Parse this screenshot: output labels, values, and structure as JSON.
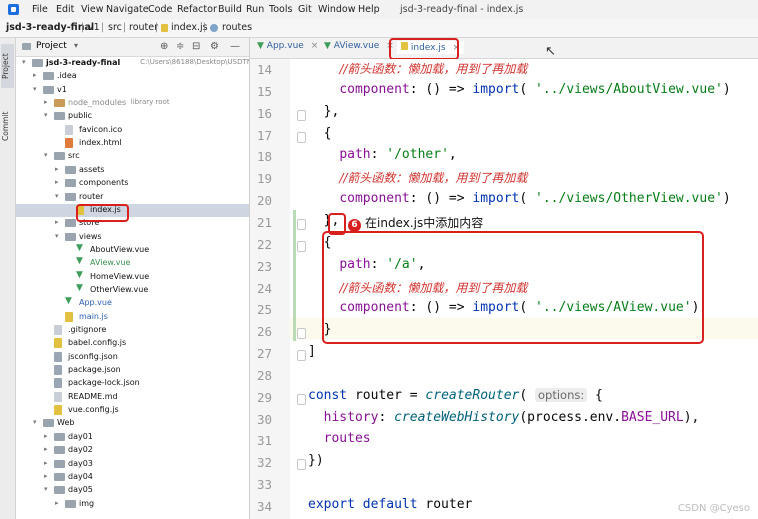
{
  "menubar": {
    "items": [
      "File",
      "Edit",
      "View",
      "Navigate",
      "Code",
      "Refactor",
      "Build",
      "Run",
      "Tools",
      "Git",
      "Window",
      "Help"
    ],
    "window_title": "jsd-3-ready-final - index.js"
  },
  "breadcrumb": [
    "jsd-3-ready-final",
    "v1",
    "src",
    "router",
    "index.js",
    "routes"
  ],
  "side_strip": {
    "project_tab": "Project",
    "commit_tab": "Commit"
  },
  "project_panel": {
    "title": "Project",
    "tree": [
      {
        "label": "jsd-3-ready-final",
        "extra": "C:\\Users\\86188\\Desktop\\USDTN-3",
        "indent": 0,
        "kind": "folder",
        "open": true
      },
      {
        "label": ".idea",
        "indent": 1,
        "kind": "folder",
        "open": false
      },
      {
        "label": "v1",
        "indent": 1,
        "kind": "folder",
        "open": true
      },
      {
        "label": "node_modules",
        "extra": "library root",
        "indent": 2,
        "kind": "folder-orange",
        "open": false,
        "muted": true
      },
      {
        "label": "public",
        "indent": 2,
        "kind": "folder",
        "open": true
      },
      {
        "label": "favicon.ico",
        "indent": 3,
        "kind": "file"
      },
      {
        "label": "index.html",
        "indent": 3,
        "kind": "html"
      },
      {
        "label": "src",
        "indent": 2,
        "kind": "folder",
        "open": true
      },
      {
        "label": "assets",
        "indent": 3,
        "kind": "folder",
        "open": false
      },
      {
        "label": "components",
        "indent": 3,
        "kind": "folder",
        "open": false
      },
      {
        "label": "router",
        "indent": 3,
        "kind": "folder",
        "open": true
      },
      {
        "label": "index.js",
        "indent": 4,
        "kind": "js",
        "selected": true
      },
      {
        "label": "store",
        "indent": 3,
        "kind": "folder",
        "open": false
      },
      {
        "label": "views",
        "indent": 3,
        "kind": "folder",
        "open": true
      },
      {
        "label": "AboutView.vue",
        "indent": 4,
        "kind": "vue"
      },
      {
        "label": "AView.vue",
        "indent": 4,
        "kind": "vue",
        "green": true
      },
      {
        "label": "HomeView.vue",
        "indent": 4,
        "kind": "vue"
      },
      {
        "label": "OtherView.vue",
        "indent": 4,
        "kind": "vue"
      },
      {
        "label": "App.vue",
        "indent": 3,
        "kind": "vue",
        "blue": true
      },
      {
        "label": "main.js",
        "indent": 3,
        "kind": "js",
        "blue": true
      },
      {
        "label": ".gitignore",
        "indent": 2,
        "kind": "file"
      },
      {
        "label": "babel.config.js",
        "indent": 2,
        "kind": "js"
      },
      {
        "label": "jsconfig.json",
        "indent": 2,
        "kind": "json"
      },
      {
        "label": "package.json",
        "indent": 2,
        "kind": "json"
      },
      {
        "label": "package-lock.json",
        "indent": 2,
        "kind": "json"
      },
      {
        "label": "README.md",
        "indent": 2,
        "kind": "file"
      },
      {
        "label": "vue.config.js",
        "indent": 2,
        "kind": "js"
      },
      {
        "label": "Web",
        "indent": 1,
        "kind": "folder",
        "open": true
      },
      {
        "label": "day01",
        "indent": 2,
        "kind": "folder",
        "open": false
      },
      {
        "label": "day02",
        "indent": 2,
        "kind": "folder",
        "open": false
      },
      {
        "label": "day03",
        "indent": 2,
        "kind": "folder",
        "open": false
      },
      {
        "label": "day04",
        "indent": 2,
        "kind": "folder",
        "open": false
      },
      {
        "label": "day05",
        "indent": 2,
        "kind": "folder",
        "open": true
      },
      {
        "label": "img",
        "indent": 3,
        "kind": "folder",
        "open": false
      }
    ]
  },
  "editor_tabs": [
    "App.vue",
    "AView.vue",
    "index.js"
  ],
  "editor": {
    "lines": [
      {
        "n": "14",
        "tokens": [
          [
            "    ",
            ""
          ],
          [
            "//箭头函数：懒加载，用到了再加载",
            "cmtc"
          ]
        ]
      },
      {
        "n": "15",
        "tokens": [
          [
            "    ",
            ""
          ],
          [
            "component",
            "prop"
          ],
          [
            ": () => ",
            ""
          ],
          [
            "import",
            "kw"
          ],
          [
            "( ",
            ""
          ],
          [
            "'../views/AboutView.vue'",
            "str"
          ],
          [
            ")",
            ""
          ]
        ]
      },
      {
        "n": "16",
        "tokens": [
          [
            "  },",
            ""
          ]
        ]
      },
      {
        "n": "17",
        "tokens": [
          [
            "  {",
            ""
          ]
        ]
      },
      {
        "n": "18",
        "tokens": [
          [
            "    ",
            ""
          ],
          [
            "path",
            "prop"
          ],
          [
            ": ",
            ""
          ],
          [
            "'/other'",
            "str"
          ],
          [
            ",",
            ""
          ]
        ]
      },
      {
        "n": "19",
        "tokens": [
          [
            "    ",
            ""
          ],
          [
            "//箭头函数：懒加载，用到了再加载",
            "cmtc"
          ]
        ]
      },
      {
        "n": "20",
        "tokens": [
          [
            "    ",
            ""
          ],
          [
            "component",
            "prop"
          ],
          [
            ": () => ",
            ""
          ],
          [
            "import",
            "kw"
          ],
          [
            "( ",
            ""
          ],
          [
            "'../views/OtherView.vue'",
            "str"
          ],
          [
            ")",
            ""
          ]
        ]
      },
      {
        "n": "21",
        "tokens": [
          [
            "  },",
            ""
          ]
        ]
      },
      {
        "n": "22",
        "tokens": [
          [
            "  {",
            ""
          ]
        ]
      },
      {
        "n": "23",
        "tokens": [
          [
            "    ",
            ""
          ],
          [
            "path",
            "prop"
          ],
          [
            ": ",
            ""
          ],
          [
            "'/a'",
            "str"
          ],
          [
            ",",
            ""
          ]
        ]
      },
      {
        "n": "24",
        "tokens": [
          [
            "    ",
            ""
          ],
          [
            "//箭头函数：懒加载，用到了再加载",
            "cmtc"
          ]
        ]
      },
      {
        "n": "25",
        "tokens": [
          [
            "    ",
            ""
          ],
          [
            "component",
            "prop"
          ],
          [
            ": () => ",
            ""
          ],
          [
            "import",
            "kw"
          ],
          [
            "( ",
            ""
          ],
          [
            "'../views/AView.vue'",
            "str"
          ],
          [
            ")",
            ""
          ]
        ]
      },
      {
        "n": "26",
        "tokens": [
          [
            "  }",
            ""
          ]
        ]
      },
      {
        "n": "27",
        "tokens": [
          [
            "]",
            ""
          ]
        ]
      },
      {
        "n": "28",
        "tokens": [
          [
            "",
            ""
          ]
        ]
      },
      {
        "n": "29",
        "tokens": [
          [
            "const ",
            "kw"
          ],
          [
            "router = ",
            ""
          ],
          [
            "createRouter",
            "fn"
          ],
          [
            "( ",
            ""
          ],
          [
            "options:",
            "hint"
          ],
          [
            " {",
            ""
          ]
        ]
      },
      {
        "n": "30",
        "tokens": [
          [
            "  ",
            ""
          ],
          [
            "history",
            "prop"
          ],
          [
            ": ",
            ""
          ],
          [
            "createWebHistory",
            "fn"
          ],
          [
            "(process.env.",
            ""
          ],
          [
            "BASE_URL",
            "prop"
          ],
          [
            "),",
            ""
          ]
        ]
      },
      {
        "n": "31",
        "tokens": [
          [
            "  ",
            ""
          ],
          [
            "routes",
            "prop"
          ]
        ]
      },
      {
        "n": "32",
        "tokens": [
          [
            "})",
            ""
          ]
        ]
      },
      {
        "n": "33",
        "tokens": [
          [
            "",
            ""
          ]
        ]
      },
      {
        "n": "34",
        "tokens": [
          [
            "export default ",
            "kw"
          ],
          [
            "router",
            ""
          ]
        ]
      }
    ]
  },
  "annotation": {
    "number": "6",
    "text": "在index.js中添加内容"
  },
  "watermark": "CSDN @Cyeso",
  "colors": {
    "annotation_red": "#d8201f",
    "keyword": "#0033b3",
    "string": "#067d17"
  }
}
